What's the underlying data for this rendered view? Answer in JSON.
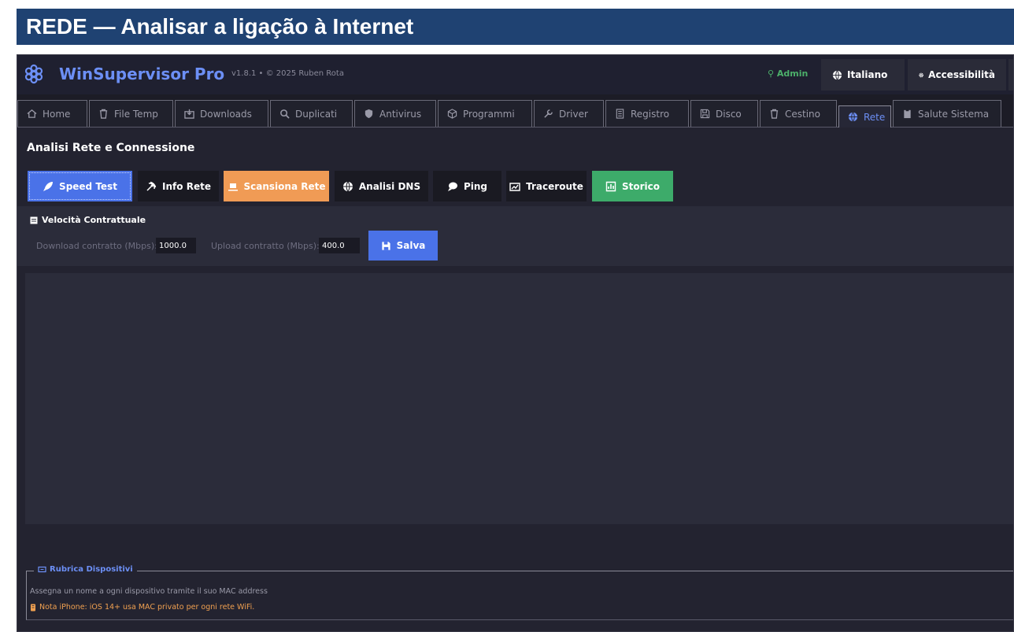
{
  "banner": {
    "title": "REDE — Analisar a ligação à Internet"
  },
  "header": {
    "app_name": "WinSupervisor Pro",
    "version": "v1.8.1 • © 2025 Ruben Rota",
    "admin_label": "Admin",
    "language_label": "Italiano",
    "accessibility_label": "Accessibilità",
    "icons": {
      "logo": "gear-flower-icon",
      "admin": "lock-icon",
      "language": "globe-icon",
      "accessibility": "gear-icon"
    }
  },
  "tabs": [
    {
      "label": "Home",
      "icon": "home-icon"
    },
    {
      "label": "File Temp",
      "icon": "trash-icon"
    },
    {
      "label": "Downloads",
      "icon": "download-folder-icon"
    },
    {
      "label": "Duplicati",
      "icon": "magnifier-icon"
    },
    {
      "label": "Antivirus",
      "icon": "shield-icon"
    },
    {
      "label": "Programmi",
      "icon": "box-icon"
    },
    {
      "label": "Driver",
      "icon": "wrench-icon"
    },
    {
      "label": "Registro",
      "icon": "document-icon"
    },
    {
      "label": "Disco",
      "icon": "floppy-icon"
    },
    {
      "label": "Cestino",
      "icon": "trash-icon"
    },
    {
      "label": "Rete",
      "icon": "globe-icon",
      "active": true
    },
    {
      "label": "Salute Sistema",
      "icon": "clipboard-icon"
    }
  ],
  "section": {
    "title": "Analisi Rete e Connessione"
  },
  "network_buttons": [
    {
      "label": "Speed Test",
      "icon": "rocket-icon",
      "style": "blue"
    },
    {
      "label": "Info Rete",
      "icon": "satellite-icon",
      "style": "dark"
    },
    {
      "label": "Scansiona Rete",
      "icon": "laptop-icon",
      "style": "orange"
    },
    {
      "label": "Analisi DNS",
      "icon": "globe-icon",
      "style": "dark"
    },
    {
      "label": "Ping",
      "icon": "speech-bubble-icon",
      "style": "dark"
    },
    {
      "label": "Traceroute",
      "icon": "map-icon",
      "style": "dark"
    },
    {
      "label": "Storico",
      "icon": "chart-icon",
      "style": "green"
    }
  ],
  "speed_panel": {
    "heading": "Velocità Contrattuale",
    "download_label": "Download contratto (Mbps):",
    "download_value": "1000.0",
    "upload_label": "Upload contratto (Mbps):",
    "upload_value": "400.0",
    "save_label": "Salva"
  },
  "rubrica": {
    "title": "Rubrica Dispositivi",
    "description": "Assegna un nome a ogni dispositivo tramite il suo MAC address",
    "note": "Nota iPhone: iOS 14+ usa MAC privato per ogni rete WiFi."
  },
  "colors": {
    "accent": "#6c8ff5",
    "banner": "#1f4272",
    "orange": "#f09b55",
    "green": "#3dab6a",
    "blue_button": "#4a72e8",
    "admin_green": "#4caf6a"
  }
}
